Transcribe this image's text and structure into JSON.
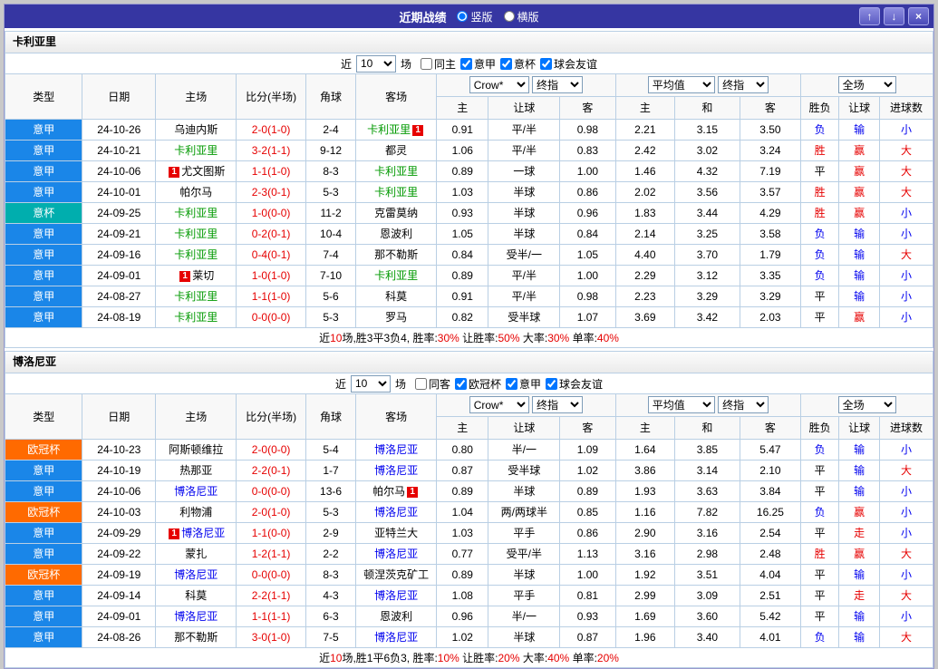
{
  "titlebar": {
    "title": "近期战绩",
    "radios": [
      {
        "label": "竖版",
        "checked": true
      },
      {
        "label": "横版",
        "checked": false
      }
    ],
    "buttons": {
      "up": "↑",
      "down": "↓",
      "close": "×"
    }
  },
  "table_columns": [
    "类型",
    "日期",
    "主场",
    "比分(半场)",
    "角球",
    "客场",
    "主",
    "让球",
    "客",
    "主",
    "和",
    "客",
    "胜负",
    "让球",
    "进球数"
  ],
  "league_colors": {
    "意甲": "#1a86e8",
    "意杯": "#00aeae",
    "欧冠杯": "#ff6a00"
  },
  "result_colors": {
    "r": "#e60000",
    "b": "#0000ee",
    "k": "#000000"
  },
  "sections": [
    {
      "team": "卡利亚里",
      "self_color": "#009900",
      "filter": {
        "prefix": "近",
        "count": "10",
        "suffix": "场",
        "checkboxes": [
          {
            "label": "同主",
            "checked": false
          },
          {
            "label": "意甲",
            "checked": true
          },
          {
            "label": "意杯",
            "checked": true
          },
          {
            "label": "球会友谊",
            "checked": true
          }
        ]
      },
      "controls": {
        "odds_source": "Crow*",
        "odds_term": "终指",
        "avg_source": "平均值",
        "avg_term": "终指",
        "scope": "全场"
      },
      "rows": [
        {
          "type": "意甲",
          "date": "24-10-26",
          "home": {
            "name": "乌迪内斯",
            "self": false
          },
          "score": "2-0(1-0)",
          "corner": "2-4",
          "away": {
            "name": "卡利亚里",
            "self": true,
            "badge": {
              "pos": "after",
              "text": "1"
            }
          },
          "odds": [
            "0.91",
            "平/半",
            "0.98"
          ],
          "avg": [
            "2.21",
            "3.15",
            "3.50"
          ],
          "result": [
            "负",
            "输",
            "小"
          ],
          "rc": [
            "b",
            "b",
            "b"
          ]
        },
        {
          "type": "意甲",
          "date": "24-10-21",
          "home": {
            "name": "卡利亚里",
            "self": true
          },
          "score": "3-2(1-1)",
          "corner": "9-12",
          "away": {
            "name": "都灵",
            "self": false
          },
          "odds": [
            "1.06",
            "平/半",
            "0.83"
          ],
          "avg": [
            "2.42",
            "3.02",
            "3.24"
          ],
          "result": [
            "胜",
            "赢",
            "大"
          ],
          "rc": [
            "r",
            "r",
            "r"
          ]
        },
        {
          "type": "意甲",
          "date": "24-10-06",
          "home": {
            "name": "尤文图斯",
            "self": false,
            "badge": {
              "pos": "before",
              "text": "1"
            }
          },
          "score": "1-1(1-0)",
          "corner": "8-3",
          "away": {
            "name": "卡利亚里",
            "self": true
          },
          "odds": [
            "0.89",
            "一球",
            "1.00"
          ],
          "avg": [
            "1.46",
            "4.32",
            "7.19"
          ],
          "result": [
            "平",
            "赢",
            "大"
          ],
          "rc": [
            "k",
            "r",
            "r"
          ]
        },
        {
          "type": "意甲",
          "date": "24-10-01",
          "home": {
            "name": "帕尔马",
            "self": false
          },
          "score": "2-3(0-1)",
          "corner": "5-3",
          "away": {
            "name": "卡利亚里",
            "self": true
          },
          "odds": [
            "1.03",
            "半球",
            "0.86"
          ],
          "avg": [
            "2.02",
            "3.56",
            "3.57"
          ],
          "result": [
            "胜",
            "赢",
            "大"
          ],
          "rc": [
            "r",
            "r",
            "r"
          ]
        },
        {
          "type": "意杯",
          "date": "24-09-25",
          "home": {
            "name": "卡利亚里",
            "self": true
          },
          "score": "1-0(0-0)",
          "corner": "11-2",
          "away": {
            "name": "克雷莫纳",
            "self": false
          },
          "odds": [
            "0.93",
            "半球",
            "0.96"
          ],
          "avg": [
            "1.83",
            "3.44",
            "4.29"
          ],
          "result": [
            "胜",
            "赢",
            "小"
          ],
          "rc": [
            "r",
            "r",
            "b"
          ]
        },
        {
          "type": "意甲",
          "date": "24-09-21",
          "home": {
            "name": "卡利亚里",
            "self": true
          },
          "score": "0-2(0-1)",
          "corner": "10-4",
          "away": {
            "name": "恩波利",
            "self": false
          },
          "odds": [
            "1.05",
            "半球",
            "0.84"
          ],
          "avg": [
            "2.14",
            "3.25",
            "3.58"
          ],
          "result": [
            "负",
            "输",
            "小"
          ],
          "rc": [
            "b",
            "b",
            "b"
          ]
        },
        {
          "type": "意甲",
          "date": "24-09-16",
          "home": {
            "name": "卡利亚里",
            "self": true
          },
          "score": "0-4(0-1)",
          "corner": "7-4",
          "away": {
            "name": "那不勒斯",
            "self": false
          },
          "odds": [
            "0.84",
            "受半/一",
            "1.05"
          ],
          "avg": [
            "4.40",
            "3.70",
            "1.79"
          ],
          "result": [
            "负",
            "输",
            "大"
          ],
          "rc": [
            "b",
            "b",
            "r"
          ]
        },
        {
          "type": "意甲",
          "date": "24-09-01",
          "home": {
            "name": "莱切",
            "self": false,
            "badge": {
              "pos": "before",
              "text": "1"
            }
          },
          "score": "1-0(1-0)",
          "corner": "7-10",
          "away": {
            "name": "卡利亚里",
            "self": true
          },
          "odds": [
            "0.89",
            "平/半",
            "1.00"
          ],
          "avg": [
            "2.29",
            "3.12",
            "3.35"
          ],
          "result": [
            "负",
            "输",
            "小"
          ],
          "rc": [
            "b",
            "b",
            "b"
          ]
        },
        {
          "type": "意甲",
          "date": "24-08-27",
          "home": {
            "name": "卡利亚里",
            "self": true
          },
          "score": "1-1(1-0)",
          "corner": "5-6",
          "away": {
            "name": "科莫",
            "self": false
          },
          "odds": [
            "0.91",
            "平/半",
            "0.98"
          ],
          "avg": [
            "2.23",
            "3.29",
            "3.29"
          ],
          "result": [
            "平",
            "输",
            "小"
          ],
          "rc": [
            "k",
            "b",
            "b"
          ]
        },
        {
          "type": "意甲",
          "date": "24-08-19",
          "home": {
            "name": "卡利亚里",
            "self": true
          },
          "score": "0-0(0-0)",
          "corner": "5-3",
          "away": {
            "name": "罗马",
            "self": false
          },
          "odds": [
            "0.82",
            "受半球",
            "1.07"
          ],
          "avg": [
            "3.69",
            "3.42",
            "2.03"
          ],
          "result": [
            "平",
            "赢",
            "小"
          ],
          "rc": [
            "k",
            "r",
            "b"
          ]
        }
      ],
      "summary": [
        [
          "近",
          "k"
        ],
        [
          "10",
          "r"
        ],
        [
          "场,胜3平3负4, 胜率:",
          "k"
        ],
        [
          "30%",
          "r"
        ],
        [
          " 让胜率:",
          "k"
        ],
        [
          "50%",
          "r"
        ],
        [
          " 大率:",
          "k"
        ],
        [
          "30%",
          "r"
        ],
        [
          " 单率:",
          "k"
        ],
        [
          "40%",
          "r"
        ]
      ]
    },
    {
      "team": "博洛尼亚",
      "self_color": "#0000ee",
      "filter": {
        "prefix": "近",
        "count": "10",
        "suffix": "场",
        "checkboxes": [
          {
            "label": "同客",
            "checked": false
          },
          {
            "label": "欧冠杯",
            "checked": true
          },
          {
            "label": "意甲",
            "checked": true
          },
          {
            "label": "球会友谊",
            "checked": true
          }
        ]
      },
      "controls": {
        "odds_source": "Crow*",
        "odds_term": "终指",
        "avg_source": "平均值",
        "avg_term": "终指",
        "scope": "全场"
      },
      "rows": [
        {
          "type": "欧冠杯",
          "date": "24-10-23",
          "home": {
            "name": "阿斯顿维拉",
            "self": false
          },
          "score": "2-0(0-0)",
          "corner": "5-4",
          "away": {
            "name": "博洛尼亚",
            "self": true
          },
          "odds": [
            "0.80",
            "半/一",
            "1.09"
          ],
          "avg": [
            "1.64",
            "3.85",
            "5.47"
          ],
          "result": [
            "负",
            "输",
            "小"
          ],
          "rc": [
            "b",
            "b",
            "b"
          ]
        },
        {
          "type": "意甲",
          "date": "24-10-19",
          "home": {
            "name": "热那亚",
            "self": false
          },
          "score": "2-2(0-1)",
          "corner": "1-7",
          "away": {
            "name": "博洛尼亚",
            "self": true
          },
          "odds": [
            "0.87",
            "受半球",
            "1.02"
          ],
          "avg": [
            "3.86",
            "3.14",
            "2.10"
          ],
          "result": [
            "平",
            "输",
            "大"
          ],
          "rc": [
            "k",
            "b",
            "r"
          ]
        },
        {
          "type": "意甲",
          "date": "24-10-06",
          "home": {
            "name": "博洛尼亚",
            "self": true
          },
          "score": "0-0(0-0)",
          "corner": "13-6",
          "away": {
            "name": "帕尔马",
            "self": false,
            "badge": {
              "pos": "after",
              "text": "1"
            }
          },
          "odds": [
            "0.89",
            "半球",
            "0.89"
          ],
          "avg": [
            "1.93",
            "3.63",
            "3.84"
          ],
          "result": [
            "平",
            "输",
            "小"
          ],
          "rc": [
            "k",
            "b",
            "b"
          ]
        },
        {
          "type": "欧冠杯",
          "date": "24-10-03",
          "home": {
            "name": "利物浦",
            "self": false
          },
          "score": "2-0(1-0)",
          "corner": "5-3",
          "away": {
            "name": "博洛尼亚",
            "self": true
          },
          "odds": [
            "1.04",
            "两/两球半",
            "0.85"
          ],
          "avg": [
            "1.16",
            "7.82",
            "16.25"
          ],
          "result": [
            "负",
            "赢",
            "小"
          ],
          "rc": [
            "b",
            "r",
            "b"
          ]
        },
        {
          "type": "意甲",
          "date": "24-09-29",
          "home": {
            "name": "博洛尼亚",
            "self": true,
            "badge": {
              "pos": "before",
              "text": "1"
            }
          },
          "score": "1-1(0-0)",
          "corner": "2-9",
          "away": {
            "name": "亚特兰大",
            "self": false
          },
          "odds": [
            "1.03",
            "平手",
            "0.86"
          ],
          "avg": [
            "2.90",
            "3.16",
            "2.54"
          ],
          "result": [
            "平",
            "走",
            "小"
          ],
          "rc": [
            "k",
            "r",
            "b"
          ]
        },
        {
          "type": "意甲",
          "date": "24-09-22",
          "home": {
            "name": "蒙扎",
            "self": false
          },
          "score": "1-2(1-1)",
          "corner": "2-2",
          "away": {
            "name": "博洛尼亚",
            "self": true
          },
          "odds": [
            "0.77",
            "受平/半",
            "1.13"
          ],
          "avg": [
            "3.16",
            "2.98",
            "2.48"
          ],
          "result": [
            "胜",
            "赢",
            "大"
          ],
          "rc": [
            "r",
            "r",
            "r"
          ]
        },
        {
          "type": "欧冠杯",
          "date": "24-09-19",
          "home": {
            "name": "博洛尼亚",
            "self": true
          },
          "score": "0-0(0-0)",
          "corner": "8-3",
          "away": {
            "name": "顿涅茨克矿工",
            "self": false
          },
          "odds": [
            "0.89",
            "半球",
            "1.00"
          ],
          "avg": [
            "1.92",
            "3.51",
            "4.04"
          ],
          "result": [
            "平",
            "输",
            "小"
          ],
          "rc": [
            "k",
            "b",
            "b"
          ]
        },
        {
          "type": "意甲",
          "date": "24-09-14",
          "home": {
            "name": "科莫",
            "self": false
          },
          "score": "2-2(1-1)",
          "corner": "4-3",
          "away": {
            "name": "博洛尼亚",
            "self": true
          },
          "odds": [
            "1.08",
            "平手",
            "0.81"
          ],
          "avg": [
            "2.99",
            "3.09",
            "2.51"
          ],
          "result": [
            "平",
            "走",
            "大"
          ],
          "rc": [
            "k",
            "r",
            "r"
          ]
        },
        {
          "type": "意甲",
          "date": "24-09-01",
          "home": {
            "name": "博洛尼亚",
            "self": true
          },
          "score": "1-1(1-1)",
          "corner": "6-3",
          "away": {
            "name": "恩波利",
            "self": false
          },
          "odds": [
            "0.96",
            "半/一",
            "0.93"
          ],
          "avg": [
            "1.69",
            "3.60",
            "5.42"
          ],
          "result": [
            "平",
            "输",
            "小"
          ],
          "rc": [
            "k",
            "b",
            "b"
          ]
        },
        {
          "type": "意甲",
          "date": "24-08-26",
          "home": {
            "name": "那不勒斯",
            "self": false
          },
          "score": "3-0(1-0)",
          "corner": "7-5",
          "away": {
            "name": "博洛尼亚",
            "self": true
          },
          "odds": [
            "1.02",
            "半球",
            "0.87"
          ],
          "avg": [
            "1.96",
            "3.40",
            "4.01"
          ],
          "result": [
            "负",
            "输",
            "大"
          ],
          "rc": [
            "b",
            "b",
            "r"
          ]
        }
      ],
      "summary": [
        [
          "近",
          "k"
        ],
        [
          "10",
          "r"
        ],
        [
          "场,胜1平6负3, 胜率:",
          "k"
        ],
        [
          "10%",
          "r"
        ],
        [
          " 让胜率:",
          "k"
        ],
        [
          "20%",
          "r"
        ],
        [
          " 大率:",
          "k"
        ],
        [
          "40%",
          "r"
        ],
        [
          " 单率:",
          "k"
        ],
        [
          "20%",
          "r"
        ]
      ]
    }
  ]
}
